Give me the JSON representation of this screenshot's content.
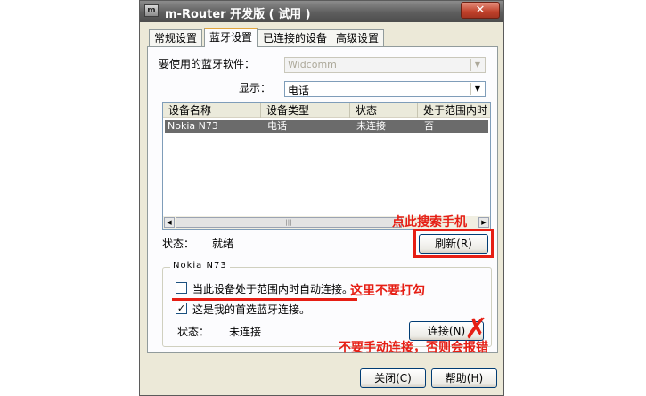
{
  "window": {
    "title": "m-Router 开发版 ( 试用 )",
    "icon_text": "m",
    "close_glyph": "✕"
  },
  "tabs": [
    {
      "label": "常规设置",
      "active": false
    },
    {
      "label": "蓝牙设置",
      "active": true
    },
    {
      "label": "已连接的设备",
      "active": false
    },
    {
      "label": "高级设置",
      "active": false
    }
  ],
  "software": {
    "label": "要使用的蓝牙软件：",
    "value": "Widcomm"
  },
  "display": {
    "label": "显示：",
    "value": "电话"
  },
  "device_list": {
    "columns": [
      "设备名称",
      "设备类型",
      "状态",
      "处于范围内时"
    ],
    "rows": [
      {
        "name": "Nokia N73",
        "type": "电话",
        "status": "未连接",
        "in_range": "否"
      }
    ],
    "scroll_grip": "|||"
  },
  "status": {
    "label": "状态：",
    "value": "就绪"
  },
  "refresh_button": "刷新(R)",
  "device_group": {
    "title": "Nokia N73",
    "auto_connect": {
      "label": "当此设备处于范围内时自动连接。",
      "checked": false
    },
    "preferred": {
      "label": "这是我的首选蓝牙连接。",
      "checked": true
    },
    "status_label": "状态：",
    "status_value": "未连接",
    "connect_button": "连接(N)"
  },
  "footer": {
    "close_button": "关闭(C)",
    "help_button": "帮助(H)"
  },
  "annotations": {
    "search_phone": "点此搜索手机",
    "no_check": "这里不要打勾",
    "no_manual": "不要手动连接，否则会报错",
    "color": "#e61e14"
  }
}
